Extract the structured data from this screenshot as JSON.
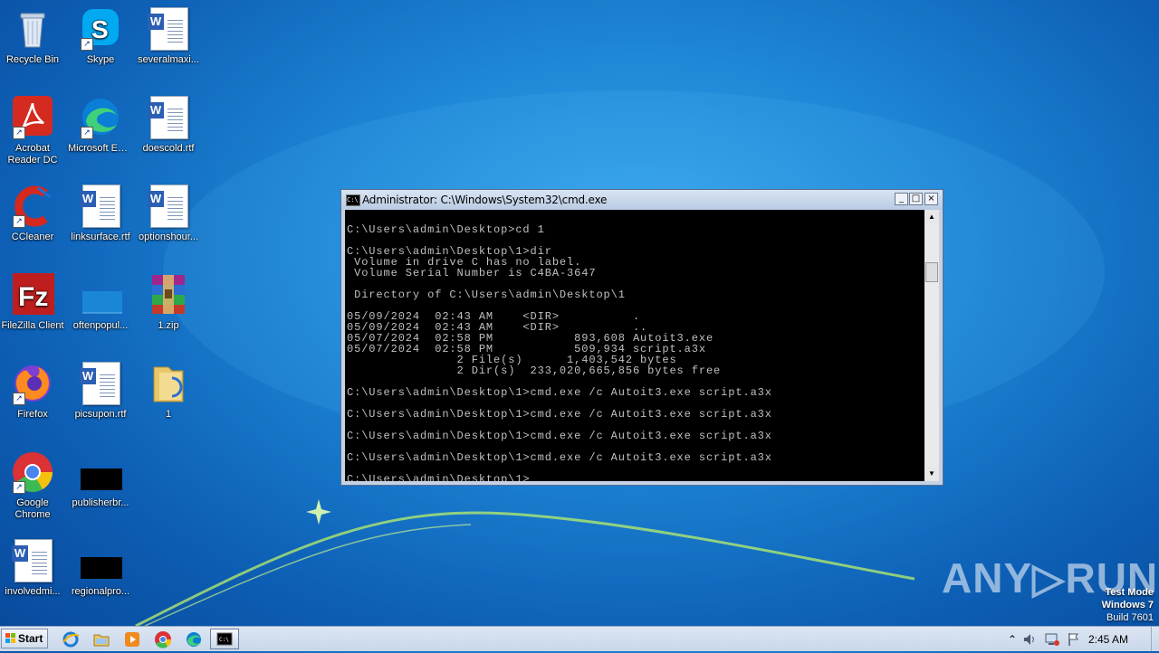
{
  "desktop": {
    "icons": [
      {
        "label": "Recycle Bin"
      },
      {
        "label": "Skype"
      },
      {
        "label": "severalmaxi..."
      },
      {
        "label": "Acrobat Reader DC"
      },
      {
        "label": "Microsoft Edge"
      },
      {
        "label": "doescold.rtf"
      },
      {
        "label": "CCleaner"
      },
      {
        "label": "linksurface.rtf"
      },
      {
        "label": "optionshour..."
      },
      {
        "label": "FileZilla Client"
      },
      {
        "label": "oftenpopul..."
      },
      {
        "label": "1.zip"
      },
      {
        "label": "Firefox"
      },
      {
        "label": "picsupon.rtf"
      },
      {
        "label": "1"
      },
      {
        "label": "Google Chrome"
      },
      {
        "label": "publisherbr..."
      },
      {
        "label": "involvedmi..."
      },
      {
        "label": "regionalpro..."
      }
    ]
  },
  "cmd": {
    "title": "Administrator: C:\\Windows\\System32\\cmd.exe",
    "icon_text": "C:\\",
    "minimize": "_",
    "maximize": "□",
    "close": "×",
    "lines": [
      "",
      "C:\\Users\\admin\\Desktop>cd 1",
      "",
      "C:\\Users\\admin\\Desktop\\1>dir",
      " Volume in drive C has no label.",
      " Volume Serial Number is C4BA-3647",
      "",
      " Directory of C:\\Users\\admin\\Desktop\\1",
      "",
      "05/09/2024  02:43 AM    <DIR>          .",
      "05/09/2024  02:43 AM    <DIR>          ..",
      "05/07/2024  02:58 PM           893,608 Autoit3.exe",
      "05/07/2024  02:58 PM           509,934 script.a3x",
      "               2 File(s)      1,403,542 bytes",
      "               2 Dir(s)  233,020,665,856 bytes free",
      "",
      "C:\\Users\\admin\\Desktop\\1>cmd.exe /c Autoit3.exe script.a3x",
      "",
      "C:\\Users\\admin\\Desktop\\1>cmd.exe /c Autoit3.exe script.a3x",
      "",
      "C:\\Users\\admin\\Desktop\\1>cmd.exe /c Autoit3.exe script.a3x",
      "",
      "C:\\Users\\admin\\Desktop\\1>cmd.exe /c Autoit3.exe script.a3x",
      "",
      "C:\\Users\\admin\\Desktop\\1>"
    ],
    "scroll_up": "▲",
    "scroll_down": "▼"
  },
  "watermark": {
    "brand": "ANY▷RUN",
    "mode_line1": "Test Mode",
    "mode_line2": "Windows 7",
    "mode_line3": "Build 7601"
  },
  "taskbar": {
    "start_label": "Start",
    "clock": "2:45 AM",
    "tray_chevron": "⌃",
    "pinned": [
      "ie-icon",
      "explorer-icon",
      "media-player-icon",
      "chrome-icon",
      "edge-icon",
      "cmd-icon"
    ]
  }
}
